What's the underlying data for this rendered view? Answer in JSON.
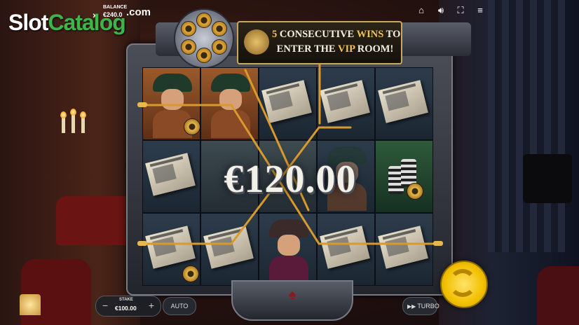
{
  "watermark": {
    "part1": "Slot",
    "part2": "Catalog",
    "suffix": ".com"
  },
  "balance": {
    "label": "BALANCE",
    "value": "€240.0"
  },
  "top_icons": [
    "home-icon",
    "sound-icon",
    "fullscreen-icon",
    "menu-icon"
  ],
  "banner": {
    "number": "5",
    "text1": "CONSECUTIVE",
    "text_highlight": "WINS",
    "text2": "TO",
    "line2_a": "ENTER THE",
    "line2_highlight": "VIP",
    "line2_b": "ROOM!"
  },
  "reels": [
    [
      "gangster-green-hat-symbol",
      "newspaper-symbol",
      "newspaper-symbol"
    ],
    [
      "gangster-green-hat-symbol",
      "wild-smoke-symbol",
      "newspaper-symbol"
    ],
    [
      "newspaper-symbol",
      "wild-smoke-symbol",
      "boss-symbol"
    ],
    [
      "newspaper-symbol",
      "gangster-shadow-symbol",
      "newspaper-symbol"
    ],
    [
      "newspaper-symbol",
      "chips-symbol",
      "newspaper-symbol"
    ]
  ],
  "win": {
    "amount": "€120.00"
  },
  "controls": {
    "stake_label": "STAKE",
    "stake_value": "€100.00",
    "minus": "−",
    "plus": "+",
    "auto_label": "AUTO",
    "turbo_label": "TURBO",
    "turbo_icon": "▶▶"
  },
  "colors": {
    "accent_gold": "#f1c25a",
    "spin_button": "#f2c000",
    "watermark_green": "#3db54a"
  }
}
